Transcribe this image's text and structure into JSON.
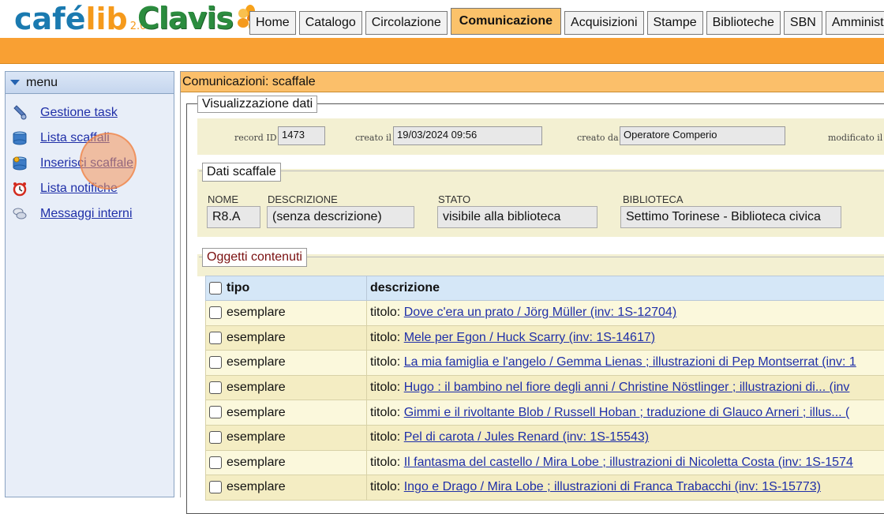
{
  "brand": {
    "cafe": "café",
    "lib": "lib",
    "version": "2.0",
    "clavis": "Clavis"
  },
  "nav": {
    "tabs": [
      "Home",
      "Catalogo",
      "Circolazione",
      "Comunicazione",
      "Acquisizioni",
      "Stampe",
      "Biblioteche",
      "SBN",
      "Amministr"
    ],
    "active": "Comunicazione"
  },
  "sidebar": {
    "title": "menu",
    "items": [
      {
        "label": "Gestione task",
        "icon": "tasks-icon"
      },
      {
        "label": "Lista scaffali",
        "icon": "shelf-list-icon"
      },
      {
        "label": "Inserisci scaffale",
        "icon": "shelf-add-icon"
      },
      {
        "label": "Lista notifiche",
        "icon": "alarm-clock-icon"
      },
      {
        "label": "Messaggi interni",
        "icon": "messages-icon"
      }
    ]
  },
  "main": {
    "title": "Comunicazioni: scaffale",
    "visualizzazione": {
      "legend": "Visualizzazione dati",
      "record_id_label": "record ID",
      "record_id": "1473",
      "creato_il_label": "creato il",
      "creato_il": "19/03/2024 09:56",
      "creato_da_label": "creato da",
      "creato_da": "Operatore Comperio",
      "modificato_il_label": "modificato il"
    },
    "dati_scaffale": {
      "legend": "Dati scaffale",
      "nome_label": "NOME",
      "nome": "R8.A",
      "descrizione_label": "DESCRIZIONE",
      "descrizione": "(senza descrizione)",
      "stato_label": "STATO",
      "stato": "visibile alla biblioteca",
      "biblioteca_label": "BIBLIOTECA",
      "biblioteca": "Settimo Torinese - Biblioteca civica"
    },
    "oggetti": {
      "legend": "Oggetti contenuti",
      "columns": [
        "tipo",
        "descrizione"
      ],
      "prefix": "titolo:",
      "rows": [
        {
          "tipo": "esemplare",
          "titolo": "Dove c'era un prato / Jörg Müller (inv: 1S-12704)"
        },
        {
          "tipo": "esemplare",
          "titolo": "Mele per Egon / Huck Scarry (inv: 1S-14617)"
        },
        {
          "tipo": "esemplare",
          "titolo": "La mia famiglia e l'angelo / Gemma Lienas ; illustrazioni di Pep Montserrat (inv: 1"
        },
        {
          "tipo": "esemplare",
          "titolo": "Hugo : il bambino nel fiore degli anni / Christine Nöstlinger ; illustrazioni di... (inv"
        },
        {
          "tipo": "esemplare",
          "titolo": "Gimmi e il rivoltante Blob / Russell Hoban ; traduzione di Glauco Arneri ; illus... ("
        },
        {
          "tipo": "esemplare",
          "titolo": "Pel di carota / Jules Renard (inv: 1S-15543)"
        },
        {
          "tipo": "esemplare",
          "titolo": "Il fantasma del castello / Mira Lobe ; illustrazioni di Nicoletta Costa (inv: 1S-1574"
        },
        {
          "tipo": "esemplare",
          "titolo": "Ingo e Drago / Mira Lobe ; illustrazioni di Franca Trabacchi (inv: 1S-15773)"
        }
      ]
    }
  },
  "colors": {
    "orange_bar": "#f9a033",
    "active_tab": "#fbc26a",
    "link": "#1f2fa8",
    "panel": "#f3f0d2",
    "table_header": "#d5e7f7"
  }
}
